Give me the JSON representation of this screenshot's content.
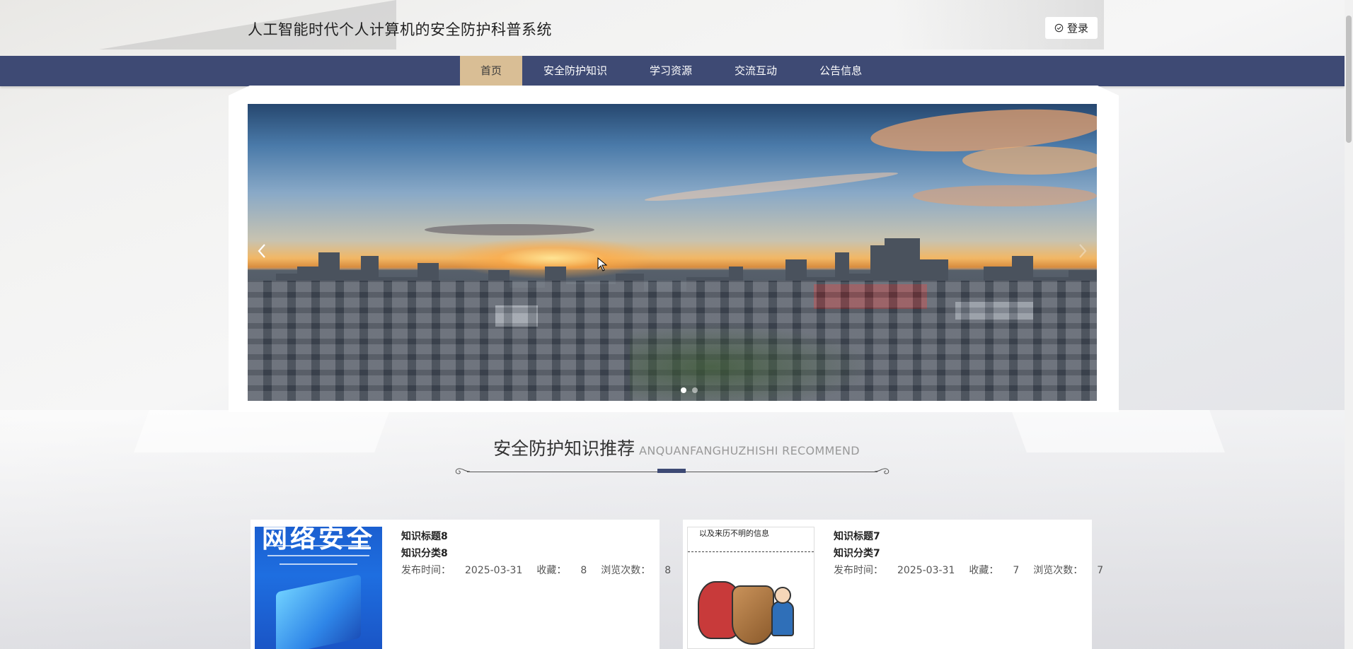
{
  "header": {
    "site_title": "人工智能时代个人计算机的安全防护科普系统",
    "login_label": "登录",
    "login_icon": "check-circle-icon"
  },
  "nav": {
    "items": [
      {
        "label": "首页",
        "active": true
      },
      {
        "label": "安全防护知识",
        "active": false
      },
      {
        "label": "学习资源",
        "active": false
      },
      {
        "label": "交流互动",
        "active": false
      },
      {
        "label": "公告信息",
        "active": false
      }
    ],
    "active_color": "#d9be95",
    "bar_color": "#3e4a74"
  },
  "carousel": {
    "prev_icon": "chevron-left-icon",
    "next_icon": "chevron-right-icon",
    "slide_count": 2,
    "active_slide": 1
  },
  "section": {
    "title_cn": "安全防护知识推荐",
    "title_en": "ANQUANFANGHUZHISHI RECOMMEND"
  },
  "cards": [
    {
      "title": "知识标题8",
      "category": "知识分类8",
      "publish_label": "发布时间：",
      "publish_time": "2025-03-31",
      "fav_label": "收藏：",
      "fav_count": "8",
      "views_label": "浏览次数：",
      "views_count": "8",
      "poster_text": "网络安全"
    },
    {
      "title": "知识标题7",
      "category": "知识分类7",
      "publish_label": "发布时间：",
      "publish_time": "2025-03-31",
      "fav_label": "收藏：",
      "fav_count": "7",
      "views_label": "浏览次数：",
      "views_count": "7",
      "poster_text": "以及来历不明的信息"
    }
  ]
}
